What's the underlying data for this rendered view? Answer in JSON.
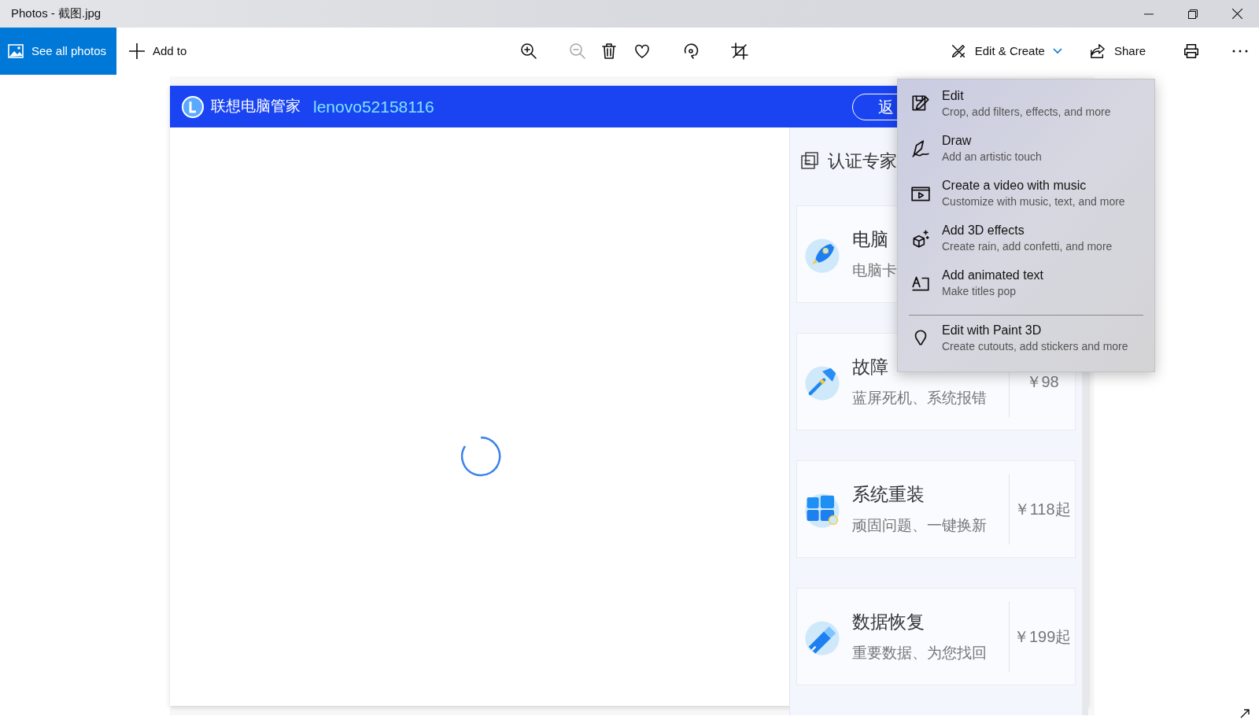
{
  "window": {
    "title": "Photos - 截图.jpg"
  },
  "toolbar": {
    "see_all": "See all photos",
    "add_to": "Add to",
    "icon_buttons": [
      {
        "disabled": false
      },
      {
        "disabled": true
      },
      {
        "disabled": false
      },
      {
        "disabled": false
      },
      {
        "disabled": false
      },
      {
        "disabled": false
      }
    ],
    "edit_create": "Edit & Create",
    "share": "Share"
  },
  "image": {
    "brand": "联想电脑管家",
    "account": "lenovo52158116",
    "back_button": "返",
    "panel_title": "认证专家",
    "cards": [
      {
        "title": "电脑",
        "subtitle": "电脑卡"
      },
      {
        "title": "故障",
        "subtitle": "蓝屏死机、系统报错",
        "price": "￥98"
      },
      {
        "title": "系统重装",
        "subtitle": "顽固问题、一键换新",
        "price": "￥118起"
      },
      {
        "title": "数据恢复",
        "subtitle": "重要数据、为您找回",
        "price": "￥199起"
      }
    ]
  },
  "menu": {
    "sections": [
      [
        {
          "title": "Edit",
          "subtitle": "Crop, add filters, effects, and more"
        },
        {
          "title": "Draw",
          "subtitle": "Add an artistic touch"
        },
        {
          "title": "Create a video with music",
          "subtitle": "Customize with music, text, and more"
        },
        {
          "title": "Add 3D effects",
          "subtitle": "Create rain, add confetti, and more"
        },
        {
          "title": "Add animated text",
          "subtitle": "Make titles pop"
        }
      ],
      [
        {
          "title": "Edit with Paint 3D",
          "subtitle": "Create cutouts, add stickers and more"
        }
      ]
    ]
  }
}
